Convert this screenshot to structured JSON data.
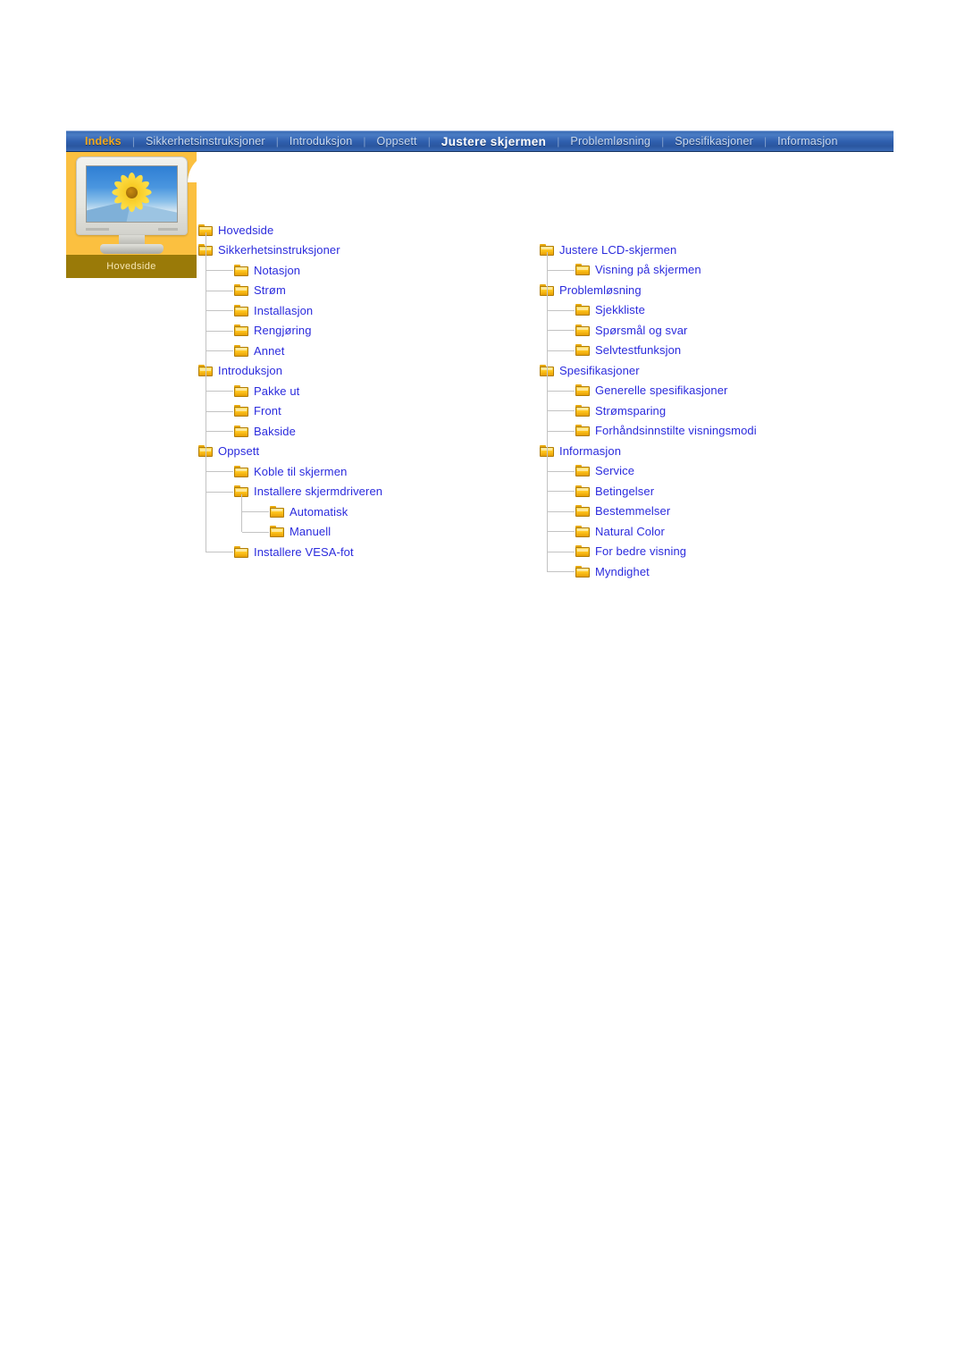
{
  "page": {
    "title": "Justere skjermen",
    "background_color": "#ffffff"
  },
  "navbar": {
    "accent_active_color": "#ffffff",
    "index_color": "#f0a81c",
    "bar_color": "#2f5fae",
    "separator": "|",
    "items": [
      {
        "label": "Indeks",
        "state": "index"
      },
      {
        "label": "Sikkerhetsinstruksjoner",
        "state": "normal"
      },
      {
        "label": "Introduksjon",
        "state": "normal"
      },
      {
        "label": "Oppsett",
        "state": "normal"
      },
      {
        "label": "Justere skjermen",
        "state": "active"
      },
      {
        "label": "Problemløsning",
        "state": "normal"
      },
      {
        "label": "Spesifikasjoner",
        "state": "normal"
      },
      {
        "label": "Informasjon",
        "state": "normal"
      }
    ]
  },
  "brand_panel": {
    "caption": "Hovedside",
    "panel_color": "#fbc040",
    "caption_bar_color": "#9a7a08",
    "monitor_icon": "crt-monitor-sunflower-wallpaper"
  },
  "sitemap": {
    "left_column": [
      {
        "label": "Hovedside",
        "level": 1
      },
      {
        "label": "Sikkerhetsinstruksjoner",
        "level": 1
      },
      {
        "label": "Notasjon",
        "level": 2
      },
      {
        "label": "Strøm",
        "level": 2
      },
      {
        "label": "Installasjon",
        "level": 2
      },
      {
        "label": "Rengjøring",
        "level": 2
      },
      {
        "label": "Annet",
        "level": 2
      },
      {
        "label": "Introduksjon",
        "level": 1
      },
      {
        "label": "Pakke ut",
        "level": 2
      },
      {
        "label": "Front",
        "level": 2
      },
      {
        "label": "Bakside",
        "level": 2
      },
      {
        "label": "Oppsett",
        "level": 1
      },
      {
        "label": "Koble til skjermen",
        "level": 2
      },
      {
        "label": "Installere skjermdriveren",
        "level": 2
      },
      {
        "label": "Automatisk",
        "level": 3
      },
      {
        "label": "Manuell",
        "level": 3
      },
      {
        "label": "Installere VESA-fot",
        "level": 2
      }
    ],
    "right_column": [
      {
        "label": "Justere LCD-skjermen",
        "level": 1
      },
      {
        "label": "Visning på skjermen",
        "level": 2
      },
      {
        "label": "Problemløsning",
        "level": 1
      },
      {
        "label": "Sjekkliste",
        "level": 2
      },
      {
        "label": "Spørsmål og svar",
        "level": 2
      },
      {
        "label": "Selvtestfunksjon",
        "level": 2
      },
      {
        "label": "Spesifikasjoner",
        "level": 1
      },
      {
        "label": "Generelle spesifikasjoner",
        "level": 2
      },
      {
        "label": "Strømsparing",
        "level": 2
      },
      {
        "label": "Forhåndsinnstilte visningsmodi",
        "level": 2
      },
      {
        "label": "Informasjon",
        "level": 1
      },
      {
        "label": "Service",
        "level": 2
      },
      {
        "label": "Betingelser",
        "level": 2
      },
      {
        "label": "Bestemmelser",
        "level": 2
      },
      {
        "label": "Natural Color",
        "level": 2
      },
      {
        "label": "For bedre visning",
        "level": 2
      },
      {
        "label": "Myndighet",
        "level": 2
      }
    ],
    "link_color": "#2b2bdd",
    "folder_icon": "folder-icon"
  }
}
